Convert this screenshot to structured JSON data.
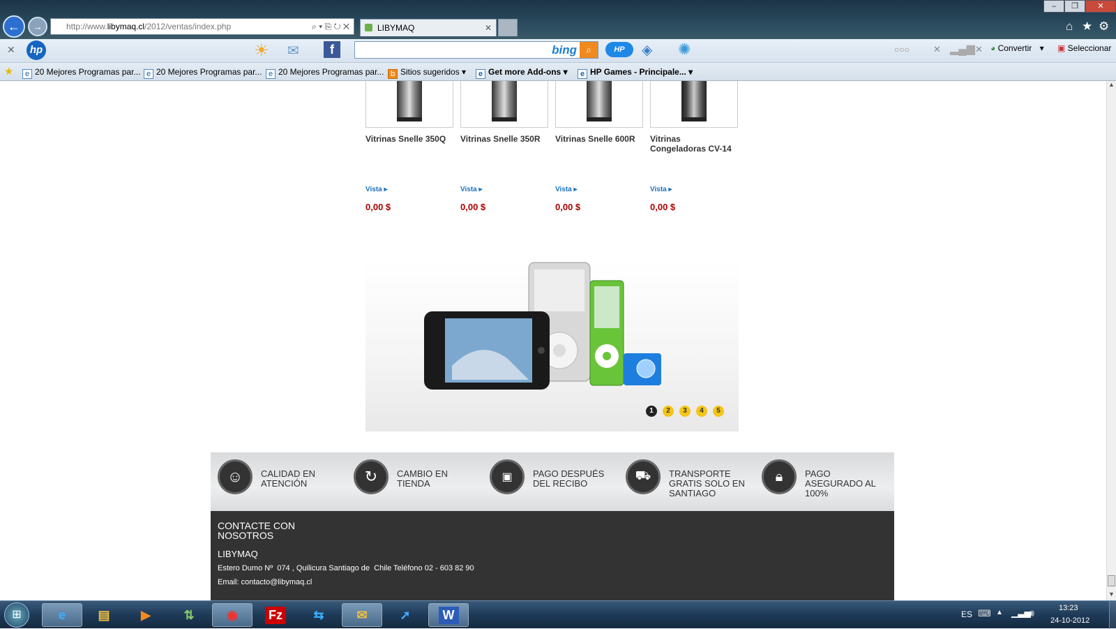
{
  "browser": {
    "url_prefix": "http://www.",
    "url_domain": "libymaq.cl",
    "url_path": "/2012/ventas/index.php",
    "tab_title": "LIBYMAQ",
    "search_brand": "bing",
    "convert_label": "Convertir",
    "select_label": "Seleccionar"
  },
  "favorites": [
    {
      "label": "20 Mejores Programas par..."
    },
    {
      "label": "20 Mejores Programas par..."
    },
    {
      "label": "20 Mejores Programas par..."
    },
    {
      "label": "Sitios sugeridos"
    },
    {
      "label": "Get more Add-ons"
    },
    {
      "label": "HP Games - Principale..."
    }
  ],
  "products": [
    {
      "name": "Vitrinas Snelle 350Q",
      "link": "Vista",
      "price": "0,00 $"
    },
    {
      "name": "Vitrinas Snelle 350R",
      "link": "Vista",
      "price": "0,00 $"
    },
    {
      "name": "Vitrinas Snelle 600R",
      "link": "Vista",
      "price": "0,00 $"
    },
    {
      "name": "Vitrinas Congeladoras CV-14",
      "link": "Vista",
      "price": "0,00 $"
    }
  ],
  "slider": {
    "pages": [
      "1",
      "2",
      "3",
      "4",
      "5"
    ],
    "active": "1"
  },
  "features": [
    {
      "icon": "smile-icon",
      "label": "CALIDAD EN ATENCIÓN"
    },
    {
      "icon": "refresh-icon",
      "label": "CAMBIO EN TIENDA"
    },
    {
      "icon": "cash-icon",
      "label": "PAGO DESPUÉS DEL RECIBO"
    },
    {
      "icon": "truck-icon",
      "label": "TRANSPORTE GRATIS SOLO EN SANTIAGO"
    },
    {
      "icon": "lock-icon",
      "label": "PAGO ASEGURADO AL 100%"
    }
  ],
  "footer": {
    "heading": "CONTACTE CON NOSOTROS",
    "company": "LIBYMAQ",
    "address": "Estero Dumo Nº  074 , Quilicura Santiago de  Chile Teléfono 02 - 603 82 90",
    "email": "Email: contacto@libymaq.cl"
  },
  "taskbar": {
    "lang": "ES",
    "time": "13:23",
    "date": "24-10-2012",
    "apps": [
      "internet-explorer",
      "file-explorer",
      "media-player",
      "update-manager",
      "chrome",
      "filezilla",
      "teamviewer",
      "outlook",
      "clicker",
      "word"
    ]
  }
}
